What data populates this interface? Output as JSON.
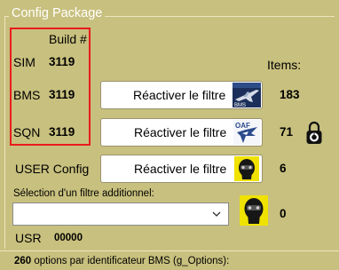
{
  "group": {
    "title": "Config Package"
  },
  "header": {
    "build_label": "Build #",
    "items_label": "Items:"
  },
  "rows": [
    {
      "name": "SIM",
      "build": "3119"
    },
    {
      "name": "BMS",
      "build": "3119",
      "button": "Réactiver le filtre",
      "icon": "bms-jet-icon",
      "items": "183"
    },
    {
      "name": "SQN",
      "build": "3119",
      "button": "Réactiver le filtre",
      "icon": "sqn-eagle-icon",
      "items": "71"
    }
  ],
  "user_config": {
    "label": "USER Config",
    "button": "Réactiver le filtre",
    "icon": "pilot-helmet-icon",
    "items": "6"
  },
  "additional_filter": {
    "label": "Sélection d'un filtre additionnel:",
    "selected": "",
    "icon": "pilot-helmet-icon",
    "items": "0"
  },
  "usr": {
    "label": "USR",
    "value": "00000"
  },
  "footer": {
    "count": "260",
    "text": "options par identificateur BMS (g_Options):"
  },
  "colors": {
    "background": "#c8c07e",
    "highlight_border": "#e81c1c"
  }
}
